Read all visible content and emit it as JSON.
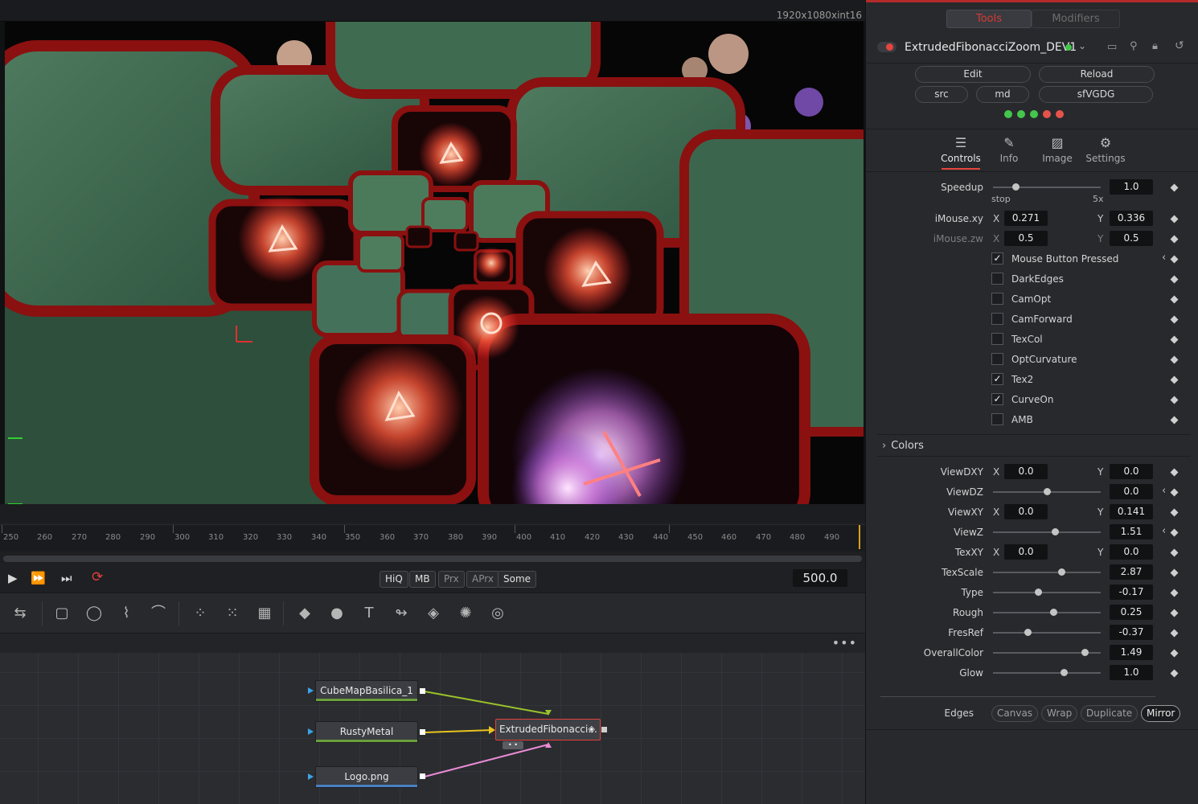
{
  "viewer": {
    "resolution": "1920x1080xint16"
  },
  "timeline": {
    "ticks": [
      "250",
      "260",
      "270",
      "280",
      "290",
      "300",
      "310",
      "320",
      "330",
      "340",
      "350",
      "360",
      "370",
      "380",
      "390",
      "400",
      "410",
      "420",
      "430",
      "440",
      "450",
      "460",
      "470",
      "480",
      "490"
    ]
  },
  "transport": {
    "quality_chips": [
      "HiQ",
      "MB",
      "Prx",
      "APrx",
      "Some"
    ],
    "current_frame": "500.0"
  },
  "flow": {
    "nodes": {
      "cubemap": "CubeMapBasilica_1",
      "rusty": "RustyMetal",
      "logo": "Logo.png",
      "main": "ExtrudedFibonacci..."
    }
  },
  "inspector": {
    "tabs": {
      "tools": "Tools",
      "modifiers": "Modifiers"
    },
    "node_name": "ExtrudedFibonacciZoom_DEV1",
    "buttons": {
      "edit": "Edit",
      "reload": "Reload",
      "src": "src",
      "md": "md",
      "sfvgdg": "sfVGDG"
    },
    "status_dots": [
      "#43c64b",
      "#43c64b",
      "#43c64b",
      "#e5534b",
      "#e5534b"
    ],
    "page_tabs": {
      "controls": "Controls",
      "info": "Info",
      "image": "Image",
      "settings": "Settings"
    },
    "speedup": {
      "label": "Speedup",
      "value": "1.0",
      "min_label": "stop",
      "max_label": "5x"
    },
    "imouse_xy": {
      "label": "iMouse.xy",
      "x": "0.271",
      "y": "0.336"
    },
    "imouse_zw": {
      "label": "iMouse.zw",
      "x": "0.5",
      "y": "0.5"
    },
    "axis": {
      "x": "X",
      "y": "Y"
    },
    "checkboxes": [
      {
        "label": "Mouse Button Pressed",
        "checked": true
      },
      {
        "label": "DarkEdges",
        "checked": false
      },
      {
        "label": "CamOpt",
        "checked": false
      },
      {
        "label": "CamForward",
        "checked": false
      },
      {
        "label": "TexCol",
        "checked": false
      },
      {
        "label": "OptCurvature",
        "checked": false
      },
      {
        "label": "Tex2",
        "checked": true
      },
      {
        "label": "CurveOn",
        "checked": true
      },
      {
        "label": "AMB",
        "checked": false
      }
    ],
    "colors_section": "Colors",
    "view_dxy": {
      "label": "ViewDXY",
      "x": "0.0",
      "y": "0.0"
    },
    "view_dz": {
      "label": "ViewDZ",
      "value": "0.0"
    },
    "view_xy": {
      "label": "ViewXY",
      "x": "0.0",
      "y": "0.141"
    },
    "view_z": {
      "label": "ViewZ",
      "value": "1.51"
    },
    "tex_xy": {
      "label": "TexXY",
      "x": "0.0",
      "y": "0.0"
    },
    "sliders": [
      {
        "label": "TexScale",
        "value": "2.87"
      },
      {
        "label": "Type",
        "value": "-0.17"
      },
      {
        "label": "Rough",
        "value": "0.25"
      },
      {
        "label": "FresRef",
        "value": "-0.37"
      },
      {
        "label": "OverallColor",
        "value": "1.49"
      },
      {
        "label": "Glow",
        "value": "1.0"
      }
    ],
    "edges": {
      "label": "Edges",
      "options": [
        "Canvas",
        "Wrap",
        "Duplicate",
        "Mirror"
      ],
      "selected": "Mirror"
    }
  }
}
